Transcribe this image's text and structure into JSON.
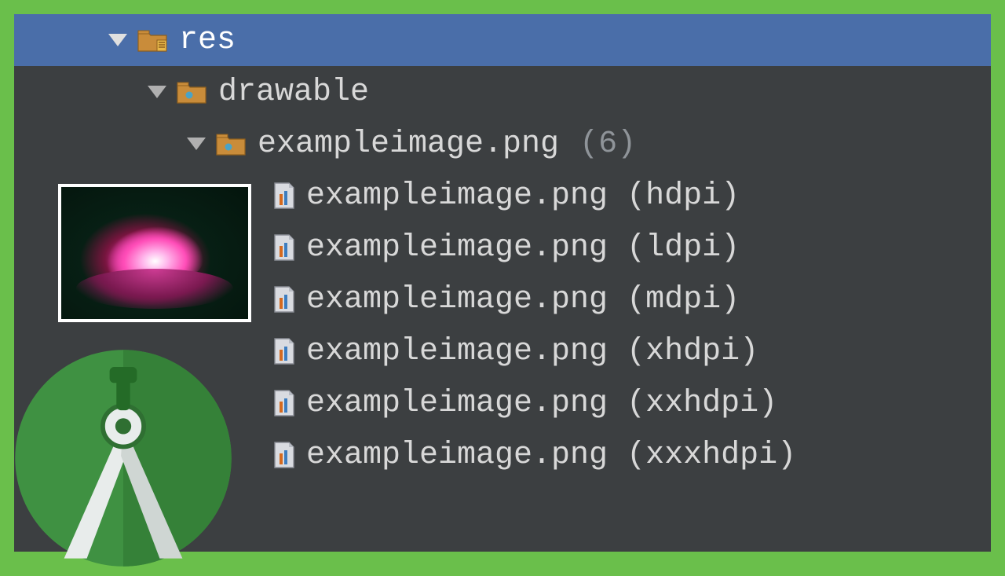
{
  "tree": {
    "root": {
      "label": "res",
      "icon": "res-folder"
    },
    "drawable": {
      "label": "drawable",
      "icon": "folder"
    },
    "group": {
      "label": "exampleimage.png",
      "count": "(6)",
      "icon": "folder"
    },
    "files": [
      {
        "name": "exampleimage.png",
        "qualifier": "(hdpi)"
      },
      {
        "name": "exampleimage.png",
        "qualifier": "(ldpi)"
      },
      {
        "name": "exampleimage.png",
        "qualifier": "(mdpi)"
      },
      {
        "name": "exampleimage.png",
        "qualifier": "(xhdpi)"
      },
      {
        "name": "exampleimage.png",
        "qualifier": "(xxhdpi)"
      },
      {
        "name": "exampleimage.png",
        "qualifier": "(xxxhdpi)"
      }
    ]
  }
}
